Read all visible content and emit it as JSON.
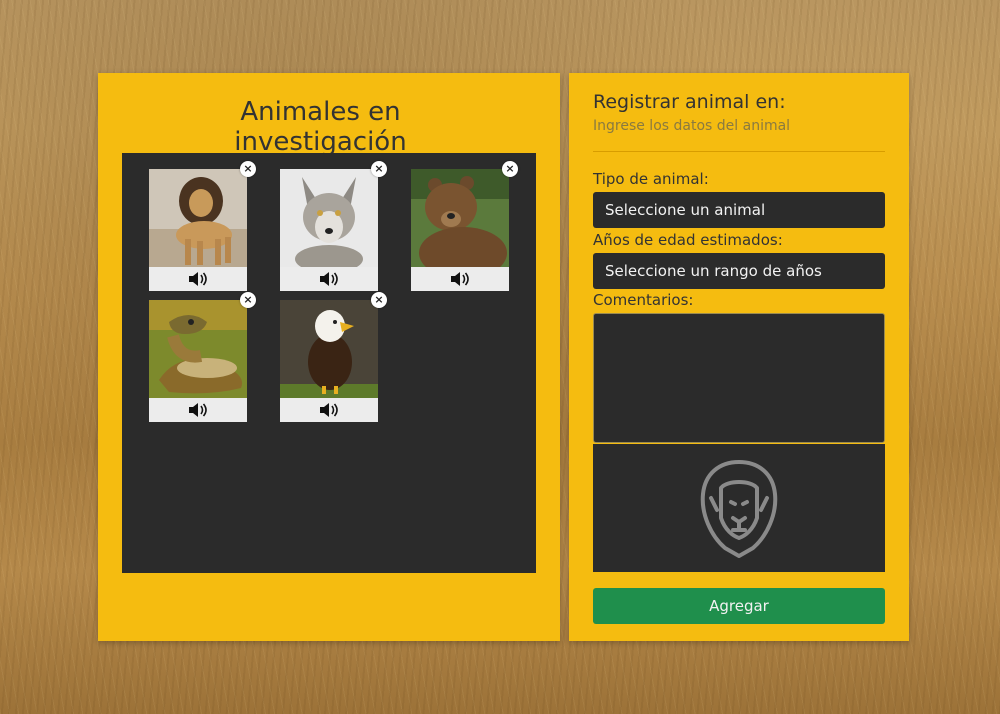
{
  "gallery": {
    "title": "Animales en investigación",
    "cards": [
      {
        "animal": "lion",
        "photo": "lion-photo",
        "close_label": "×"
      },
      {
        "animal": "wolf",
        "photo": "wolf-photo",
        "close_label": "×"
      },
      {
        "animal": "bear",
        "photo": "bear-photo",
        "close_label": "×"
      },
      {
        "animal": "snake",
        "photo": "snake-photo",
        "close_label": "×"
      },
      {
        "animal": "eagle",
        "photo": "eagle-photo",
        "close_label": "×"
      }
    ],
    "sound_icon": "speaker-icon",
    "close_icon": "close-icon"
  },
  "form": {
    "title": "Registrar animal en:",
    "subtitle": "Ingrese los datos del animal",
    "animal_type_label": "Tipo de animal:",
    "animal_type_value": "Seleccione un animal",
    "age_label": "Años de edad estimados:",
    "age_value": "Seleccione un rango de años",
    "comments_label": "Comentarios:",
    "comments_value": "",
    "preview_icon": "lion-outline-icon",
    "submit_label": "Agregar"
  },
  "colors": {
    "panel": "#f5bc10",
    "dark": "#2b2b2b",
    "button": "#1f8f4c"
  }
}
